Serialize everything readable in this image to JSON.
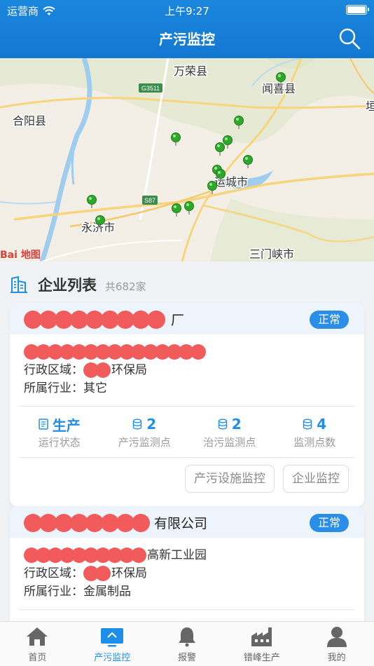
{
  "status_bar": {
    "carrier": "运营商",
    "time": "上午9:27"
  },
  "header": {
    "title": "产污监控"
  },
  "map": {
    "labels": [
      "万荣县",
      "闻喜县",
      "合阳县",
      "运城市",
      "永济市",
      "三门峡市",
      "垣"
    ],
    "road_codes": [
      "G3511",
      "S87"
    ],
    "watermark": "Bai 地图"
  },
  "section": {
    "title": "企业列表",
    "count": "共682家"
  },
  "cards": [
    {
      "name_suffix": "厂",
      "status": "正常",
      "region_label": "行政区域：",
      "region_value": "环保局",
      "industry_label": "所属行业：",
      "industry_value": "其它",
      "stats": [
        {
          "value": "生产",
          "caption": "运行状态",
          "icon": "document-icon"
        },
        {
          "value": "2",
          "caption": "产污监测点",
          "icon": "database-icon"
        },
        {
          "value": "2",
          "caption": "治污监测点",
          "icon": "database-icon"
        },
        {
          "value": "4",
          "caption": "监测点数",
          "icon": "database-icon"
        }
      ],
      "buttons": [
        "产污设施监控",
        "企业监控"
      ]
    },
    {
      "name_suffix": "有限公司",
      "status": "正常",
      "address_suffix": "高新工业园",
      "region_label": "行政区域：",
      "region_value": "环保局",
      "industry_label": "所属行业：",
      "industry_value": "金属制品"
    }
  ],
  "tabbar": [
    {
      "label": "首页",
      "icon": "home-icon"
    },
    {
      "label": "产污监控",
      "icon": "monitor-icon",
      "active": true
    },
    {
      "label": "报警",
      "icon": "bell-icon"
    },
    {
      "label": "错峰生产",
      "icon": "factory-icon"
    },
    {
      "label": "我的",
      "icon": "user-icon"
    }
  ],
  "colors": {
    "accent": "#1f8ee8",
    "header": "#1478d2",
    "badge": "#2a8ee8",
    "redaction": "#f25b5b"
  }
}
